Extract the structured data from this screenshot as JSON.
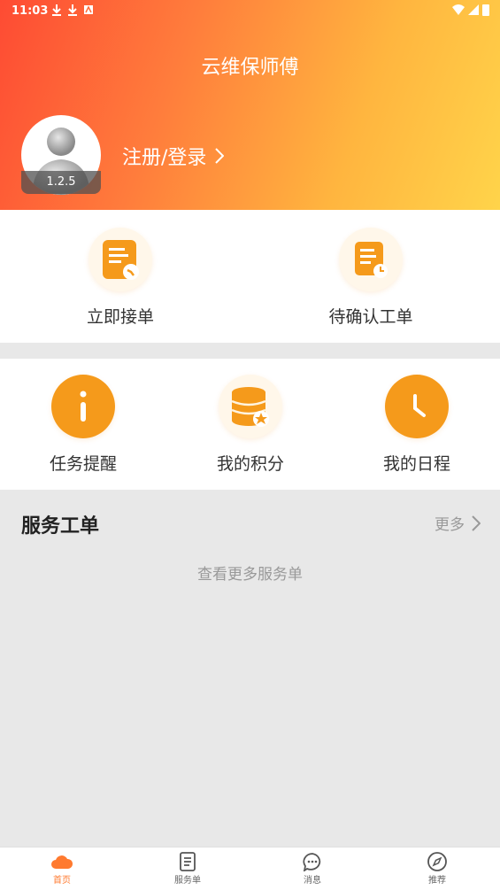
{
  "status_bar": {
    "time": "11:03"
  },
  "header": {
    "title": "云维保师傅",
    "version": "1.2.5",
    "login_label": "注册/登录"
  },
  "quick_actions": [
    {
      "label": "立即接单",
      "icon": "accept-order-icon"
    },
    {
      "label": "待确认工单",
      "icon": "pending-order-icon"
    }
  ],
  "features": [
    {
      "label": "任务提醒",
      "icon": "info-icon"
    },
    {
      "label": "我的积分",
      "icon": "points-icon"
    },
    {
      "label": "我的日程",
      "icon": "clock-icon"
    }
  ],
  "service_orders": {
    "title": "服务工单",
    "more_label": "更多",
    "empty_text": "查看更多服务单"
  },
  "tabbar": {
    "items": [
      {
        "label": "首页",
        "icon": "home-cloud-icon",
        "active": true
      },
      {
        "label": "服务单",
        "icon": "document-icon",
        "active": false
      },
      {
        "label": "消息",
        "icon": "chat-icon",
        "active": false
      },
      {
        "label": "推荐",
        "icon": "compass-icon",
        "active": false
      }
    ]
  },
  "colors": {
    "accent": "#ff7a2f",
    "orange_icon": "#f59a1b"
  }
}
